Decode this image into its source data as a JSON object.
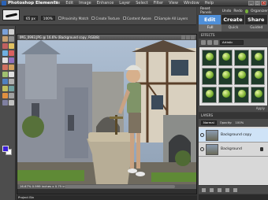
{
  "app": {
    "title": "Photoshop Elements",
    "menu": [
      "File",
      "Edit",
      "Image",
      "Enhance",
      "Layer",
      "Select",
      "Filter",
      "View",
      "Window",
      "Help"
    ],
    "window_controls": [
      "_",
      "□",
      "×"
    ]
  },
  "options_bar": {
    "size_value": "65 px",
    "opacity_value": "100%",
    "proximity_match": "Proximity Match",
    "create_texture": "Create Texture",
    "sample_all_layers": "Sample All Layers",
    "checkbox_label_1": "Content Aware"
  },
  "right_top": {
    "items": [
      "Reset Panels",
      "Undo",
      "Redo",
      "Organizer"
    ]
  },
  "mode_tabs": {
    "items": [
      {
        "label": "Edit",
        "active": true
      },
      {
        "label": "Create",
        "active": false
      },
      {
        "label": "Share",
        "active": false
      }
    ]
  },
  "sub_tabs": {
    "items": [
      {
        "label": "Full",
        "active": true
      },
      {
        "label": "Quick",
        "active": false
      },
      {
        "label": "Guided",
        "active": false
      }
    ]
  },
  "document": {
    "title": "IMG_0993.JPG @ 16.6% (Background copy, RGB/8)",
    "status": "16.67%  0.999 inches x 0.75 inches (300 ppi)",
    "app_status": "Project Bin"
  },
  "effects": {
    "header": "EFFECTS",
    "filter_select": "Artistic",
    "apply_label": "Apply"
  },
  "layers": {
    "header": "LAYERS",
    "mode": "Normal",
    "opacity_label": "Opacity:",
    "opacity_value": "100%",
    "items": [
      {
        "name": "Background copy",
        "selected": true,
        "locked": false
      },
      {
        "name": "Background",
        "selected": false,
        "locked": true
      }
    ]
  },
  "colors": {
    "foreground": "#3b1fd9",
    "background": "#ffffff",
    "accent": "#4f8fd8"
  }
}
